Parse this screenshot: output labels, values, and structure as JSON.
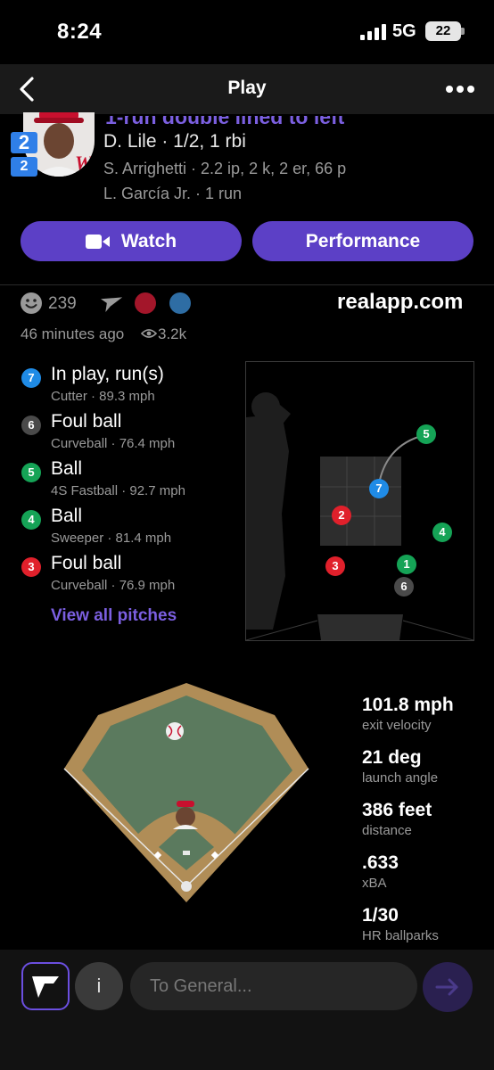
{
  "status_bar": {
    "time": "8:24",
    "network": "5G",
    "battery": "22"
  },
  "nav": {
    "title": "Play"
  },
  "play": {
    "headline": "1-run double lined to left",
    "score": [
      "2",
      "2"
    ],
    "batter_line": "D. Lile · 1/2, 1 rbi",
    "pitcher_line": "S. Arrighetti · 2.2 ip, 2 k, 2 er, 66 p",
    "runner_line": "L. García Jr. · 1 run"
  },
  "actions": {
    "watch_label": "Watch",
    "performance_label": "Performance"
  },
  "social": {
    "reaction_count": "239",
    "site": "realapp.com",
    "time_ago": "46 minutes ago",
    "views": "3.2k",
    "team_colors": [
      "#a3162a",
      "#2e6da4"
    ]
  },
  "pitches": [
    {
      "num": "7",
      "result": "In play, run(s)",
      "detail": "Cutter · 89.3 mph",
      "color": "#1f8be6"
    },
    {
      "num": "6",
      "result": "Foul ball",
      "detail": "Curveball · 76.4 mph",
      "color": "#4a4a4a"
    },
    {
      "num": "5",
      "result": "Ball",
      "detail": "4S Fastball · 92.7 mph",
      "color": "#15a356"
    },
    {
      "num": "4",
      "result": "Ball",
      "detail": "Sweeper · 81.4 mph",
      "color": "#15a356"
    },
    {
      "num": "3",
      "result": "Foul ball",
      "detail": "Curveball · 76.9 mph",
      "color": "#e0202b"
    }
  ],
  "view_all_label": "View all pitches",
  "hit_stats": [
    {
      "value": "101.8 mph",
      "label": "exit velocity"
    },
    {
      "value": "21 deg",
      "label": "launch angle"
    },
    {
      "value": "386 feet",
      "label": "distance"
    },
    {
      "value": ".633",
      "label": "xBA"
    },
    {
      "value": "1/30",
      "label": "HR ballparks"
    }
  ],
  "composer": {
    "placeholder": "To General...",
    "info_label": "i"
  },
  "colors": {
    "accent": "#5c40c6",
    "accent_text": "#7b5fe0",
    "field_green": "#5b7a5e",
    "field_dirt": "#b08d57"
  }
}
